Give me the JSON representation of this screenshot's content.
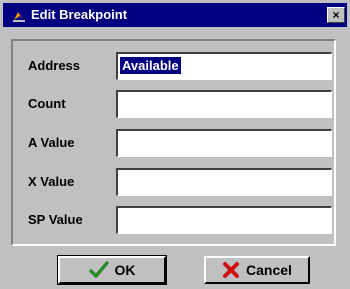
{
  "window": {
    "title": "Edit Breakpoint",
    "close_glyph": "×"
  },
  "form": {
    "fields": [
      {
        "label": "Address",
        "value": "Available"
      },
      {
        "label": "Count",
        "value": ""
      },
      {
        "label": "A Value",
        "value": ""
      },
      {
        "label": "X Value",
        "value": ""
      },
      {
        "label": "SP Value",
        "value": ""
      }
    ]
  },
  "buttons": {
    "ok_label": "OK",
    "cancel_label": "Cancel",
    "ok_icon": "checkmark-icon",
    "cancel_icon": "x-icon"
  },
  "colors": {
    "title_bar": "#000080",
    "selection": "#000080",
    "ok_check": "#2a8a2a",
    "cancel_x": "#d01010"
  }
}
